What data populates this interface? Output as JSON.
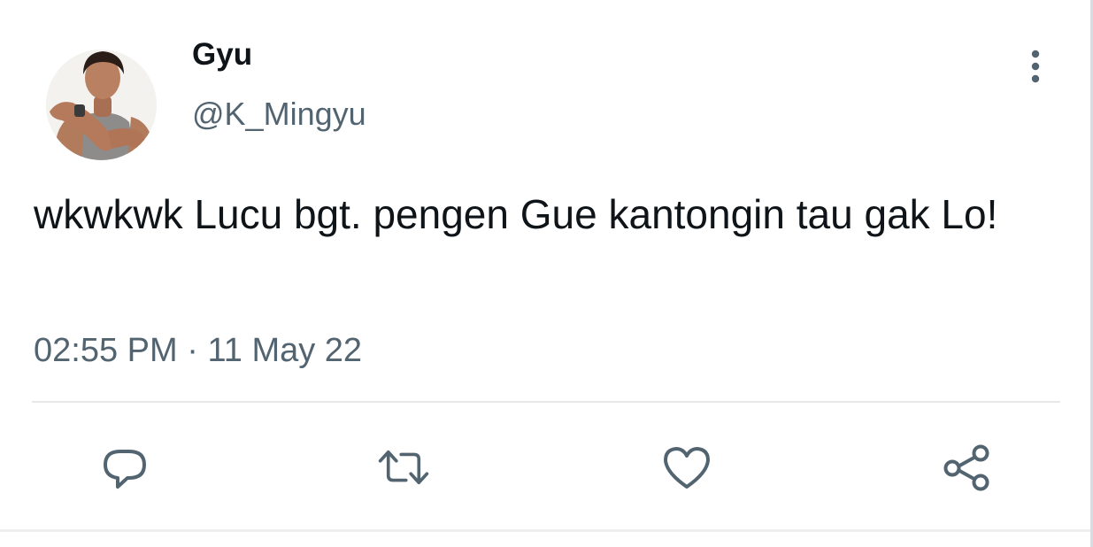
{
  "tweet": {
    "display_name": "Gyu",
    "handle": "@K_Mingyu",
    "text": "wkwkwk Lucu bgt. pengen Gue kantongin tau gak Lo!",
    "time": "02:55 PM",
    "separator": "·",
    "date": "11 May 22"
  },
  "icons": {
    "more": "more-vertical-icon",
    "reply": "reply-icon",
    "retweet": "retweet-icon",
    "like": "heart-icon",
    "share": "share-icon"
  },
  "colors": {
    "text_primary": "#0f1419",
    "text_secondary": "#536471",
    "icon": "#536471",
    "divider": "#e6e8ea"
  }
}
